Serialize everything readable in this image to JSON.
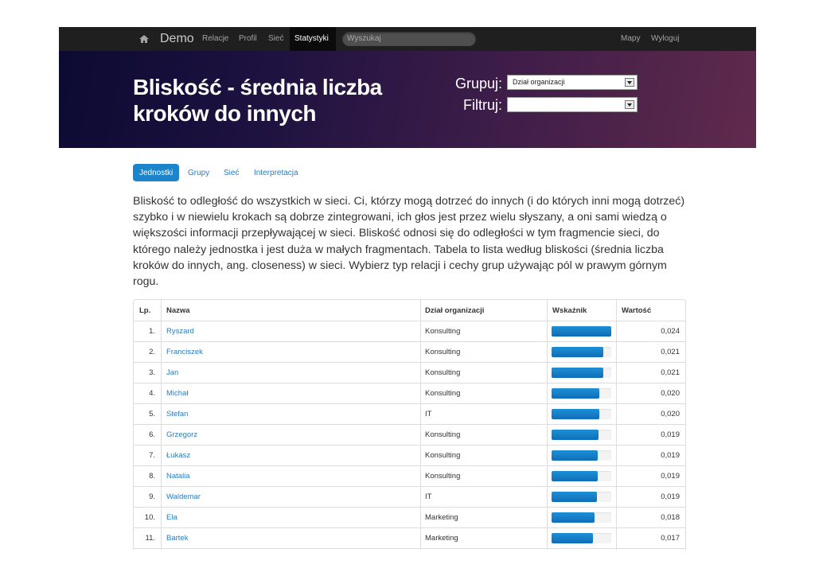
{
  "navbar": {
    "brand": "Demo",
    "links": [
      "Relacje",
      "Profil",
      "Sieć"
    ],
    "active": "Statystyki",
    "search_placeholder": "Wyszukaj",
    "right_links": [
      "Mapy",
      "Wyloguj"
    ]
  },
  "hero": {
    "title": "Bliskość - średnia liczba kroków do innych",
    "group_label": "Grupuj:",
    "group_value": "Dział organizacji",
    "filter_label": "Filtruj:",
    "filter_value": ""
  },
  "tabs": {
    "active": "Jednostki",
    "items": [
      "Grupy",
      "Sieć",
      "Interpretacja"
    ]
  },
  "description": "Bliskość to odległość do wszystkich w sieci. Ci, którzy mogą dotrzeć do innych (i do których inni mogą dotrzeć) szybko i w niewielu krokach są dobrze zintegrowani, ich głos jest przez wielu słyszany, a oni sami wiedzą o większości informacji przepływającej w sieci. Bliskość odnosi się do odległości w tym fragmencie sieci, do którego należy jednostka i jest duża w małych fragmentach. Tabela to lista według bliskości (średnia liczba kroków do innych, ang. closeness) w sieci. Wybierz typ relacji i cechy grup używając pól w prawym górnym rogu.",
  "table": {
    "headers": [
      "Lp.",
      "Nazwa",
      "Dział organizacji",
      "Wskaźnik",
      "Wartość"
    ],
    "rows": [
      {
        "lp": "1.",
        "name": "Ryszard",
        "dept": "Konsulting",
        "indicator": 1.0,
        "value": "0,024"
      },
      {
        "lp": "2.",
        "name": "Franciszek",
        "dept": "Konsulting",
        "indicator": 0.87,
        "value": "0,021"
      },
      {
        "lp": "3.",
        "name": "Jan",
        "dept": "Konsulting",
        "indicator": 0.87,
        "value": "0,021"
      },
      {
        "lp": "4.",
        "name": "Michał",
        "dept": "Konsulting",
        "indicator": 0.8,
        "value": "0,020"
      },
      {
        "lp": "5.",
        "name": "Stefan",
        "dept": "IT",
        "indicator": 0.8,
        "value": "0,020"
      },
      {
        "lp": "6.",
        "name": "Grzegorz",
        "dept": "Konsulting",
        "indicator": 0.79,
        "value": "0,019"
      },
      {
        "lp": "7.",
        "name": "Łukasz",
        "dept": "Konsulting",
        "indicator": 0.77,
        "value": "0,019"
      },
      {
        "lp": "8.",
        "name": "Natalia",
        "dept": "Konsulting",
        "indicator": 0.77,
        "value": "0,019"
      },
      {
        "lp": "9.",
        "name": "Waldemar",
        "dept": "IT",
        "indicator": 0.76,
        "value": "0,019"
      },
      {
        "lp": "10.",
        "name": "Ela",
        "dept": "Marketing",
        "indicator": 0.72,
        "value": "0,018"
      },
      {
        "lp": "11.",
        "name": "Bartek",
        "dept": "Marketing",
        "indicator": 0.69,
        "value": "0,017"
      },
      {
        "lp": "",
        "name": "",
        "dept": "",
        "indicator": 0,
        "value": ""
      }
    ]
  },
  "colors": {
    "accent": "#1b84cb",
    "link": "#2a7dbd",
    "bar": "#1d8fd6",
    "navbar": "#1f1f1f"
  }
}
